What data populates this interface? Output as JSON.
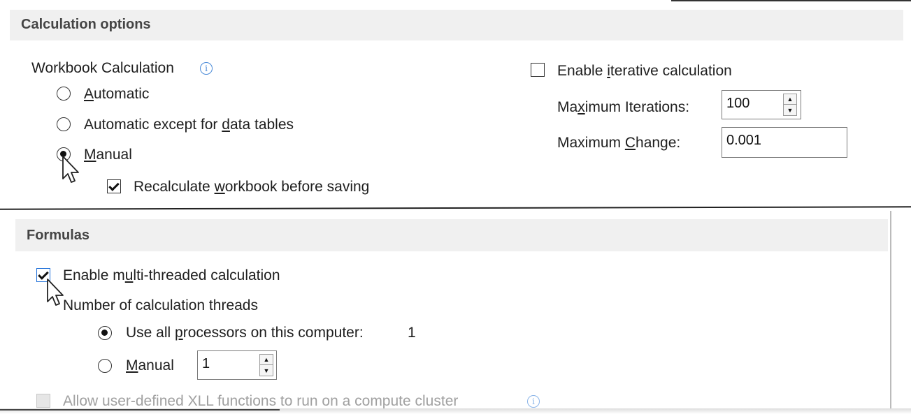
{
  "calculation": {
    "header": "Calculation options",
    "workbook_label": "Workbook Calculation",
    "options": [
      {
        "pre": "",
        "ul": "A",
        "post": "utomatic",
        "checked": false
      },
      {
        "pre": "Automatic except for ",
        "ul": "d",
        "post": "ata tables",
        "checked": false
      },
      {
        "pre": "",
        "ul": "M",
        "post": "anual",
        "checked": true
      }
    ],
    "recalc": {
      "pre": "Recalculate ",
      "ul": "w",
      "post": "orkbook before saving",
      "checked": true
    },
    "iterative": {
      "pre": "Enable ",
      "ul": "i",
      "post": "terative calculation",
      "checked": false
    },
    "max_iter": {
      "pre": "Ma",
      "ul": "x",
      "post": "imum Iterations:",
      "value": "100"
    },
    "max_change": {
      "pre": "Maximum ",
      "ul": "C",
      "post": "hange:",
      "value": "0.001"
    }
  },
  "formulas": {
    "header": "Formulas",
    "multithread": {
      "pre": "Enable m",
      "ul": "u",
      "post": "lti-threaded calculation",
      "checked": true
    },
    "threads_label": "Number of calculation threads",
    "all_procs": {
      "pre": "Use all ",
      "ul": "p",
      "post": "rocessors on this computer:",
      "count": "1",
      "checked": true
    },
    "manual": {
      "pre": "",
      "ul": "M",
      "post": "anual",
      "value": "1",
      "checked": false
    },
    "xll": {
      "text": "Allow user-defined XLL functions to run on a compute cluster",
      "checked": false
    }
  }
}
